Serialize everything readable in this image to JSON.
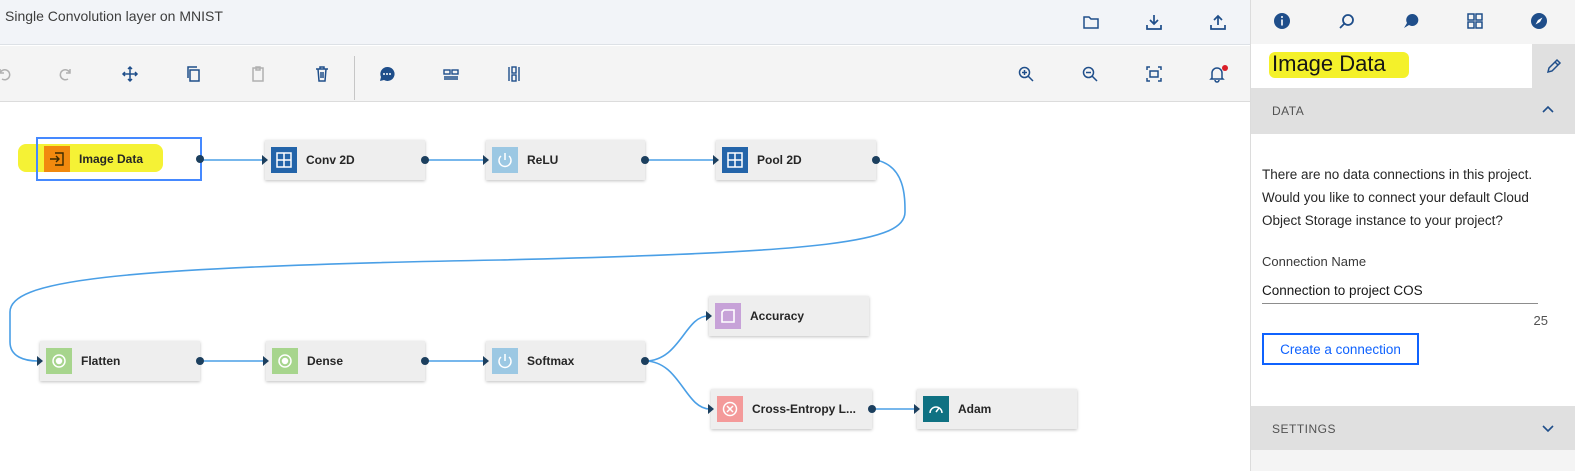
{
  "app": {
    "flow_title": "Single Convolution layer on MNIST"
  },
  "topbar": {
    "icons": [
      "folder-icon",
      "download-icon",
      "upload-icon"
    ]
  },
  "toolbar": {
    "tools": [
      "undo-icon",
      "redo-icon",
      "move-icon",
      "copy-icon",
      "paste-icon",
      "delete-icon",
      "comment-icon",
      "arrange-horizontal-icon",
      "arrange-vertical-icon",
      "zoom-in-icon",
      "zoom-out-icon",
      "zoom-to-fit-icon",
      "notifications-icon"
    ]
  },
  "canvas": {
    "nodes": [
      {
        "id": "image-data",
        "label": "Image Data",
        "icon": "data-input-icon",
        "color": "#f1890e",
        "selected": true
      },
      {
        "id": "conv2d",
        "label": "Conv 2D",
        "icon": "grid-icon",
        "color": "#2364a9"
      },
      {
        "id": "relu",
        "label": "ReLU",
        "icon": "power-icon",
        "color": "#9cc8e3"
      },
      {
        "id": "pool2d",
        "label": "Pool 2D",
        "icon": "grid-icon",
        "color": "#2364a9"
      },
      {
        "id": "flatten",
        "label": "Flatten",
        "icon": "radio-icon",
        "color": "#a7d58d"
      },
      {
        "id": "dense",
        "label": "Dense",
        "icon": "radio-icon",
        "color": "#a7d58d"
      },
      {
        "id": "softmax",
        "label": "Softmax",
        "icon": "power-icon",
        "color": "#9cc8e3"
      },
      {
        "id": "accuracy",
        "label": "Accuracy",
        "icon": "square-icon",
        "color": "#c7a2d8"
      },
      {
        "id": "cross-entropy",
        "label": "Cross-Entropy L...",
        "icon": "close-circle-icon",
        "color": "#f49a9a"
      },
      {
        "id": "adam",
        "label": "Adam",
        "icon": "gauge-icon",
        "color": "#0f7182"
      }
    ]
  },
  "panel": {
    "tabs": [
      "info-icon",
      "search-icon",
      "palette-icon",
      "dashboard-icon",
      "compass-icon"
    ],
    "title": "Image Data",
    "data_section": {
      "title": "DATA",
      "message": "There are no data connections in this project. Would you like to connect your default Cloud Object Storage instance to your project?",
      "connection_label": "Connection Name",
      "connection_value": "Connection to project COS",
      "char_count": "25",
      "create_button": "Create a connection"
    },
    "settings_section": {
      "title": "SETTINGS"
    }
  },
  "colors": {
    "accent": "#0f62fe",
    "link": "#4a9fe6",
    "highlight": "#f4f12a"
  }
}
